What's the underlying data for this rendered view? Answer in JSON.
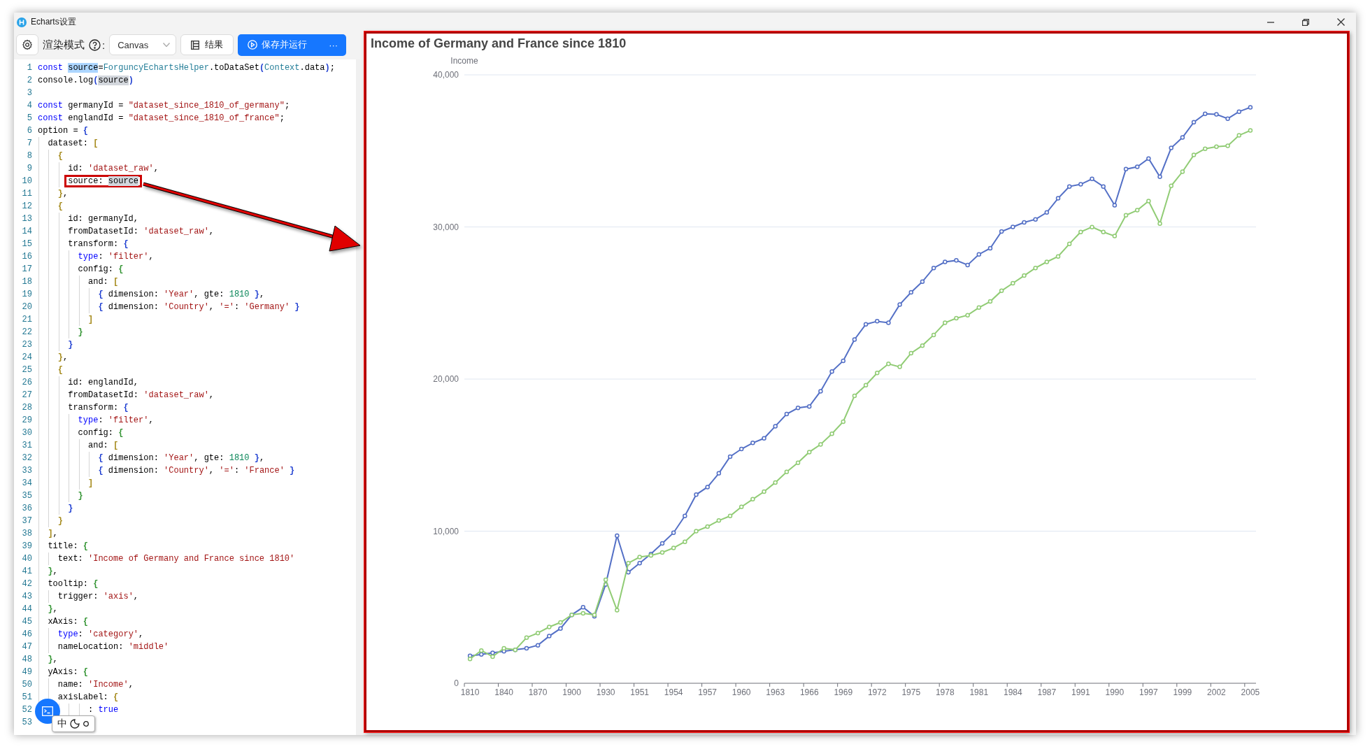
{
  "window": {
    "title": "Echarts设置"
  },
  "toolbar": {
    "render_mode_label": "渲染模式",
    "colon": ":",
    "mode_select": {
      "value": "Canvas"
    },
    "result_button": "结果",
    "run_button": "保存并运行",
    "more_button": "···"
  },
  "editor": {
    "lines": [
      {
        "n": "1",
        "tokens": [
          {
            "text": "const",
            "kind": "keyword"
          },
          {
            "text": " source",
            "selected": true
          },
          {
            "text": "="
          },
          {
            "text": "ForguncyEchartsHelper",
            "kind": "type"
          },
          {
            "text": ".toDataSet"
          },
          {
            "text": "(",
            "kind": "bracket",
            "color": "#1f3fd1"
          },
          {
            "text": "Context",
            "kind": "type"
          },
          {
            "text": ".data"
          },
          {
            "text": ")",
            "kind": "bracket",
            "color": "#1f3fd1"
          },
          {
            "text": ";"
          }
        ]
      },
      {
        "n": "2",
        "tokens": [
          {
            "text": "console.log"
          },
          {
            "text": "(",
            "kind": "bracket",
            "color": "#1f3fd1"
          },
          {
            "text": "source",
            "highlighted": true
          },
          {
            "text": ")",
            "kind": "bracket",
            "color": "#1f3fd1"
          }
        ]
      },
      {
        "n": "3"
      },
      {
        "n": "4",
        "tokens": [
          {
            "text": "const",
            "kind": "keyword"
          },
          {
            "text": " germanyId = "
          },
          {
            "text": "\"dataset_since_1810_of_germany\"",
            "kind": "string"
          },
          {
            "text": ";"
          }
        ]
      },
      {
        "n": "5",
        "tokens": [
          {
            "text": "const",
            "kind": "keyword"
          },
          {
            "text": " englandId = "
          },
          {
            "text": "\"dataset_since_1810_of_france\"",
            "kind": "string"
          },
          {
            "text": ";"
          }
        ]
      },
      {
        "n": "6",
        "tokens": [
          {
            "text": "option = "
          },
          {
            "text": "{",
            "kind": "bracket",
            "color": "#1f3fd1"
          }
        ]
      },
      {
        "n": "7",
        "tokens": [
          {
            "text": "  dataset: "
          },
          {
            "text": "[",
            "kind": "bracket",
            "color": "#a58a1b"
          }
        ]
      },
      {
        "n": "8",
        "tokens": [
          {
            "text": "    {",
            "kind": "bracket",
            "color": "#a58a1b"
          }
        ]
      },
      {
        "n": "9",
        "tokens": [
          {
            "text": "      id: "
          },
          {
            "text": "'dataset_raw'",
            "kind": "string"
          },
          {
            "text": ","
          }
        ]
      },
      {
        "n": "10",
        "boxed": true,
        "tokens": [
          {
            "text": "      source: "
          },
          {
            "text": "source",
            "highlighted": true
          }
        ]
      },
      {
        "n": "11",
        "tokens": [
          {
            "text": "    }",
            "kind": "bracket",
            "color": "#a58a1b"
          },
          {
            "text": ","
          }
        ]
      },
      {
        "n": "12",
        "tokens": [
          {
            "text": "    {",
            "kind": "bracket",
            "color": "#a58a1b"
          }
        ]
      },
      {
        "n": "13",
        "tokens": [
          {
            "text": "      id: germanyId,"
          }
        ]
      },
      {
        "n": "14",
        "tokens": [
          {
            "text": "      fromDatasetId: "
          },
          {
            "text": "'dataset_raw'",
            "kind": "string"
          },
          {
            "text": ","
          }
        ]
      },
      {
        "n": "15",
        "tokens": [
          {
            "text": "      transform: "
          },
          {
            "text": "{",
            "kind": "bracket",
            "color": "#1f3fd1"
          }
        ]
      },
      {
        "n": "16",
        "tokens": [
          {
            "text": "        type",
            "kind": "keyword"
          },
          {
            "text": ": "
          },
          {
            "text": "'filter'",
            "kind": "string"
          },
          {
            "text": ","
          }
        ]
      },
      {
        "n": "17",
        "tokens": [
          {
            "text": "        config: "
          },
          {
            "text": "{",
            "kind": "bracket",
            "color": "#319331"
          }
        ]
      },
      {
        "n": "18",
        "tokens": [
          {
            "text": "          and: "
          },
          {
            "text": "[",
            "kind": "bracket",
            "color": "#a58a1b"
          }
        ]
      },
      {
        "n": "19",
        "tokens": [
          {
            "text": "            {",
            "kind": "bracket",
            "color": "#1f3fd1"
          },
          {
            "text": " dimension: "
          },
          {
            "text": "'Year'",
            "kind": "string"
          },
          {
            "text": ", gte: "
          },
          {
            "text": "1810",
            "kind": "number"
          },
          {
            "text": " }",
            "kind": "bracket",
            "color": "#1f3fd1"
          },
          {
            "text": ","
          }
        ]
      },
      {
        "n": "20",
        "tokens": [
          {
            "text": "            {",
            "kind": "bracket",
            "color": "#1f3fd1"
          },
          {
            "text": " dimension: "
          },
          {
            "text": "'Country'",
            "kind": "string"
          },
          {
            "text": ", "
          },
          {
            "text": "'='",
            "kind": "string"
          },
          {
            "text": ": "
          },
          {
            "text": "'Germany'",
            "kind": "string"
          },
          {
            "text": " }",
            "kind": "bracket",
            "color": "#1f3fd1"
          }
        ]
      },
      {
        "n": "21",
        "tokens": [
          {
            "text": "          ]",
            "kind": "bracket",
            "color": "#a58a1b"
          }
        ]
      },
      {
        "n": "22",
        "tokens": [
          {
            "text": "        }",
            "kind": "bracket",
            "color": "#319331"
          }
        ]
      },
      {
        "n": "23",
        "tokens": [
          {
            "text": "      }",
            "kind": "bracket",
            "color": "#1f3fd1"
          }
        ]
      },
      {
        "n": "24",
        "tokens": [
          {
            "text": "    }",
            "kind": "bracket",
            "color": "#a58a1b"
          },
          {
            "text": ","
          }
        ]
      },
      {
        "n": "25",
        "tokens": [
          {
            "text": "    {",
            "kind": "bracket",
            "color": "#a58a1b"
          }
        ]
      },
      {
        "n": "26",
        "tokens": [
          {
            "text": "      id: englandId,"
          }
        ]
      },
      {
        "n": "27",
        "tokens": [
          {
            "text": "      fromDatasetId: "
          },
          {
            "text": "'dataset_raw'",
            "kind": "string"
          },
          {
            "text": ","
          }
        ]
      },
      {
        "n": "28",
        "tokens": [
          {
            "text": "      transform: "
          },
          {
            "text": "{",
            "kind": "bracket",
            "color": "#1f3fd1"
          }
        ]
      },
      {
        "n": "29",
        "tokens": [
          {
            "text": "        type",
            "kind": "keyword"
          },
          {
            "text": ": "
          },
          {
            "text": "'filter'",
            "kind": "string"
          },
          {
            "text": ","
          }
        ]
      },
      {
        "n": "30",
        "tokens": [
          {
            "text": "        config: "
          },
          {
            "text": "{",
            "kind": "bracket",
            "color": "#319331"
          }
        ]
      },
      {
        "n": "31",
        "tokens": [
          {
            "text": "          and: "
          },
          {
            "text": "[",
            "kind": "bracket",
            "color": "#a58a1b"
          }
        ]
      },
      {
        "n": "32",
        "tokens": [
          {
            "text": "            {",
            "kind": "bracket",
            "color": "#1f3fd1"
          },
          {
            "text": " dimension: "
          },
          {
            "text": "'Year'",
            "kind": "string"
          },
          {
            "text": ", gte: "
          },
          {
            "text": "1810",
            "kind": "number"
          },
          {
            "text": " }",
            "kind": "bracket",
            "color": "#1f3fd1"
          },
          {
            "text": ","
          }
        ]
      },
      {
        "n": "33",
        "tokens": [
          {
            "text": "            {",
            "kind": "bracket",
            "color": "#1f3fd1"
          },
          {
            "text": " dimension: "
          },
          {
            "text": "'Country'",
            "kind": "string"
          },
          {
            "text": ", "
          },
          {
            "text": "'='",
            "kind": "string"
          },
          {
            "text": ": "
          },
          {
            "text": "'France'",
            "kind": "string"
          },
          {
            "text": " }",
            "kind": "bracket",
            "color": "#1f3fd1"
          }
        ]
      },
      {
        "n": "34",
        "tokens": [
          {
            "text": "          ]",
            "kind": "bracket",
            "color": "#a58a1b"
          }
        ]
      },
      {
        "n": "35",
        "tokens": [
          {
            "text": "        }",
            "kind": "bracket",
            "color": "#319331"
          }
        ]
      },
      {
        "n": "36",
        "tokens": [
          {
            "text": "      }",
            "kind": "bracket",
            "color": "#1f3fd1"
          }
        ]
      },
      {
        "n": "37",
        "tokens": [
          {
            "text": "    }",
            "kind": "bracket",
            "color": "#a58a1b"
          }
        ]
      },
      {
        "n": "38",
        "tokens": [
          {
            "text": "  ]",
            "kind": "bracket",
            "color": "#a58a1b"
          },
          {
            "text": ","
          }
        ]
      },
      {
        "n": "39",
        "tokens": [
          {
            "text": "  title: "
          },
          {
            "text": "{",
            "kind": "bracket",
            "color": "#319331"
          }
        ]
      },
      {
        "n": "40",
        "tokens": [
          {
            "text": "    text: "
          },
          {
            "text": "'Income of Germany and France since 1810'",
            "kind": "string"
          }
        ]
      },
      {
        "n": "41",
        "tokens": [
          {
            "text": "  }",
            "kind": "bracket",
            "color": "#319331"
          },
          {
            "text": ","
          }
        ]
      },
      {
        "n": "42",
        "tokens": [
          {
            "text": "  tooltip: "
          },
          {
            "text": "{",
            "kind": "bracket",
            "color": "#319331"
          }
        ]
      },
      {
        "n": "43",
        "tokens": [
          {
            "text": "    trigger: "
          },
          {
            "text": "'axis'",
            "kind": "string"
          },
          {
            "text": ","
          }
        ]
      },
      {
        "n": "44",
        "tokens": [
          {
            "text": "  }",
            "kind": "bracket",
            "color": "#319331"
          },
          {
            "text": ","
          }
        ]
      },
      {
        "n": "45",
        "tokens": [
          {
            "text": "  xAxis: "
          },
          {
            "text": "{",
            "kind": "bracket",
            "color": "#319331"
          }
        ]
      },
      {
        "n": "46",
        "tokens": [
          {
            "text": "    type",
            "kind": "keyword"
          },
          {
            "text": ": "
          },
          {
            "text": "'category'",
            "kind": "string"
          },
          {
            "text": ","
          }
        ]
      },
      {
        "n": "47",
        "tokens": [
          {
            "text": "    nameLocation: "
          },
          {
            "text": "'middle'",
            "kind": "string"
          }
        ]
      },
      {
        "n": "48",
        "tokens": [
          {
            "text": "  }",
            "kind": "bracket",
            "color": "#319331"
          },
          {
            "text": ","
          }
        ]
      },
      {
        "n": "49",
        "tokens": [
          {
            "text": "  yAxis: "
          },
          {
            "text": "{",
            "kind": "bracket",
            "color": "#319331"
          }
        ]
      },
      {
        "n": "50",
        "tokens": [
          {
            "text": "    name: "
          },
          {
            "text": "'Income'",
            "kind": "string"
          },
          {
            "text": ","
          }
        ]
      },
      {
        "n": "51",
        "tokens": [
          {
            "text": "    axisLabel: "
          },
          {
            "text": "{",
            "kind": "bracket",
            "color": "#a58a1b"
          }
        ]
      },
      {
        "n": "52",
        "tokens": [
          {
            "text": "          : "
          },
          {
            "text": "true",
            "kind": "keyword"
          }
        ]
      },
      {
        "n": "53"
      }
    ]
  },
  "ime_toolbar": {
    "label": "中"
  },
  "chart": {
    "chart_data": {
      "type": "line",
      "title": "Income of Germany and France since 1810",
      "ylabel": "Income",
      "categories": [
        "1810",
        null,
        null,
        "1840",
        null,
        null,
        "1870",
        null,
        null,
        "1900",
        null,
        null,
        "1930",
        null,
        null,
        "1951",
        null,
        null,
        "1954",
        null,
        null,
        "1957",
        null,
        null,
        "1960",
        null,
        null,
        "1963",
        null,
        null,
        "1966",
        null,
        null,
        "1969",
        null,
        null,
        "1972",
        null,
        null,
        "1975",
        null,
        null,
        "1978",
        null,
        null,
        "1981",
        null,
        null,
        "1984",
        null,
        null,
        "1987",
        null,
        null,
        "1991",
        null,
        null,
        "1990",
        null,
        null,
        "1997",
        null,
        null,
        "1999",
        null,
        null,
        "2002",
        null,
        null,
        "2005"
      ],
      "ylim": [
        0,
        40000
      ],
      "grid": true,
      "yticks": [
        {
          "value": 0,
          "label": "0"
        },
        {
          "value": 10000,
          "label": "10,000"
        },
        {
          "value": 20000,
          "label": "20,000"
        },
        {
          "value": 30000,
          "label": "30,000"
        },
        {
          "value": 40000,
          "label": "40,000"
        }
      ],
      "series": [
        {
          "color": "#5470c6",
          "marker": "circle",
          "values": [
            1800,
            1900,
            2000,
            2100,
            2200,
            2300,
            2500,
            3100,
            3600,
            4500,
            5000,
            4400,
            6500,
            9700,
            7300,
            7900,
            8500,
            9200,
            9900,
            11000,
            12400,
            12900,
            13800,
            14900,
            15400,
            15800,
            16100,
            16900,
            17700,
            18100,
            18200,
            19200,
            20500,
            21200,
            22600,
            23600,
            23800,
            23700,
            24900,
            25700,
            26400,
            27300,
            27700,
            27800,
            27500,
            28200,
            28600,
            29700,
            30000,
            30300,
            30500,
            30950,
            31880,
            32660,
            32800,
            33160,
            32660,
            31420,
            33800,
            33950,
            34500,
            33300,
            35190,
            35880,
            36890,
            37440,
            37400,
            37120,
            37580,
            37860
          ]
        },
        {
          "color": "#91cc75",
          "marker": "circle",
          "values": [
            1600,
            2150,
            1750,
            2300,
            2200,
            3000,
            3300,
            3700,
            4000,
            4500,
            4600,
            4500,
            6800,
            4800,
            7900,
            8300,
            8400,
            8600,
            8900,
            9300,
            10000,
            10300,
            10700,
            11000,
            11600,
            12100,
            12600,
            13200,
            13900,
            14500,
            15200,
            15700,
            16400,
            17200,
            18900,
            19600,
            20400,
            21000,
            20800,
            21700,
            22200,
            22900,
            23700,
            24000,
            24200,
            24700,
            25100,
            25800,
            26300,
            26800,
            27300,
            27700,
            28060,
            28890,
            29670,
            29990,
            29670,
            29400,
            30770,
            31100,
            31700,
            30220,
            32700,
            33630,
            34730,
            35140,
            35280,
            35330,
            36020,
            36340
          ]
        }
      ]
    }
  }
}
